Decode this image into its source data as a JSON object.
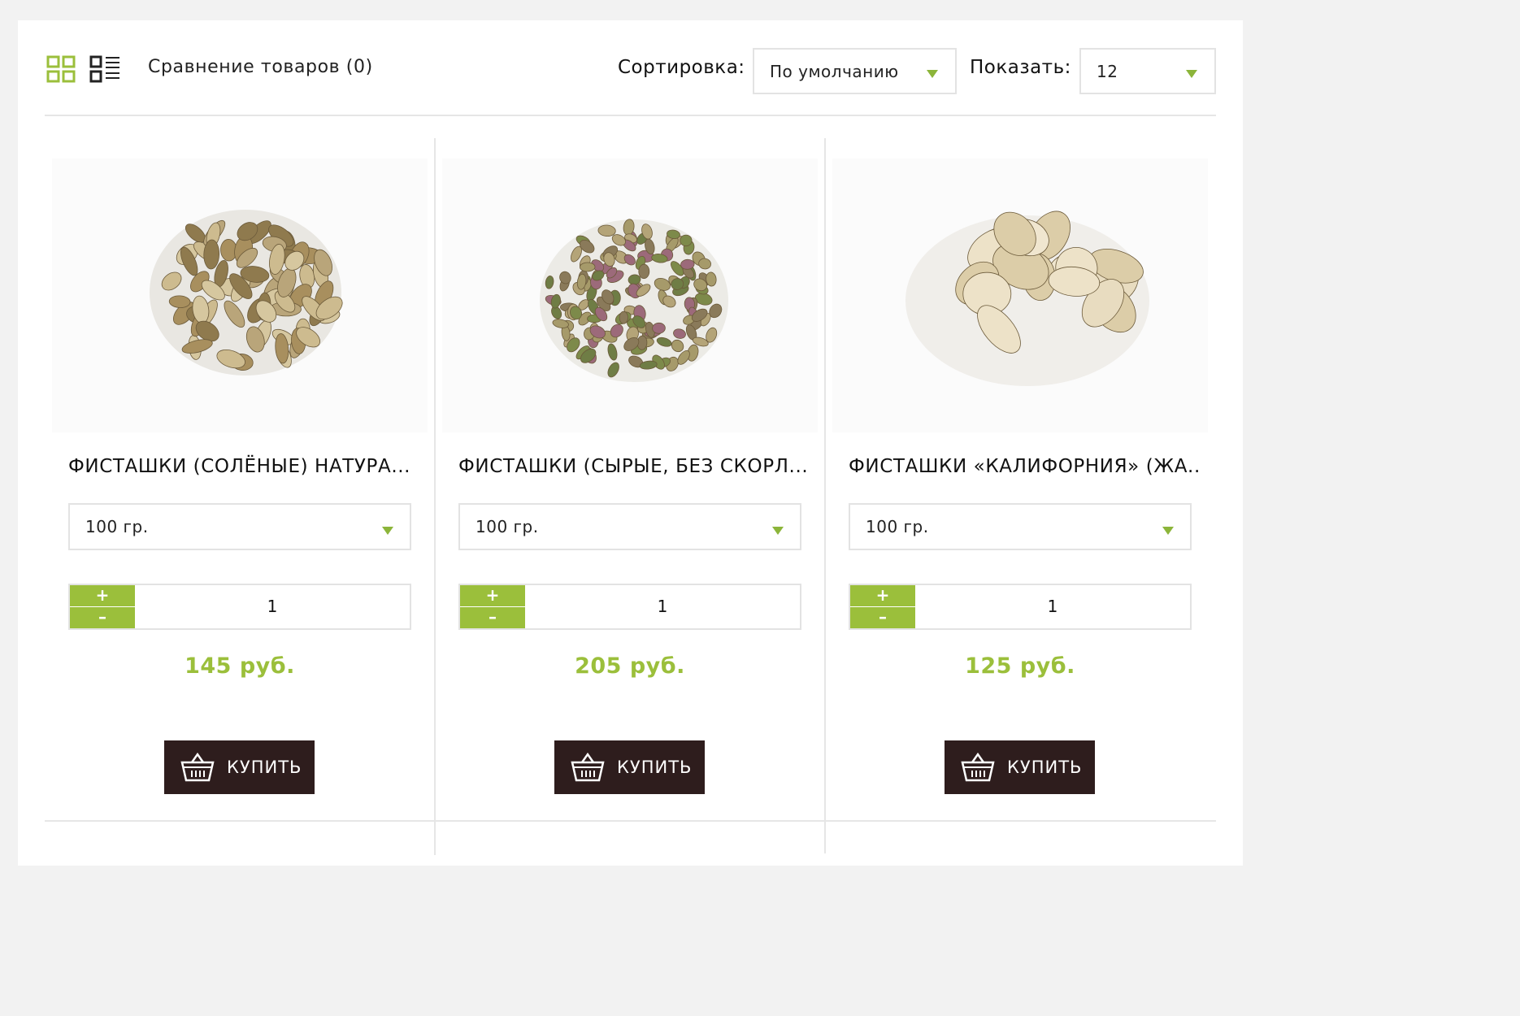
{
  "toolbar": {
    "grid_view_icon": "grid-view-icon",
    "list_view_icon": "list-view-icon",
    "compare_label": "Сравнение товаров (0)",
    "sort_label": "Сортировка:",
    "sort_value": "По умолчанию",
    "show_label": "Показать:",
    "show_value": "12"
  },
  "colors": {
    "accent": "#9bbf3b",
    "button_dark": "#2e1d1d",
    "border": "#e3e3e3"
  },
  "products": [
    {
      "title": "ФИСТАШКИ (СОЛЁНЫЕ) НАТУРА...",
      "weight": "100 гр.",
      "quantity": "1",
      "plus": "+",
      "minus": "–",
      "price": "145 руб.",
      "buy_label": "КУПИТЬ"
    },
    {
      "title": "ФИСТАШКИ (СЫРЫЕ, БЕЗ СКОРЛ...",
      "weight": "100 гр.",
      "quantity": "1",
      "plus": "+",
      "minus": "–",
      "price": "205 руб.",
      "buy_label": "КУПИТЬ"
    },
    {
      "title": "ФИСТАШКИ «КАЛИФОРНИЯ» (ЖА...",
      "weight": "100 гр.",
      "quantity": "1",
      "plus": "+",
      "minus": "–",
      "price": "125 руб.",
      "buy_label": "КУПИТЬ"
    }
  ]
}
